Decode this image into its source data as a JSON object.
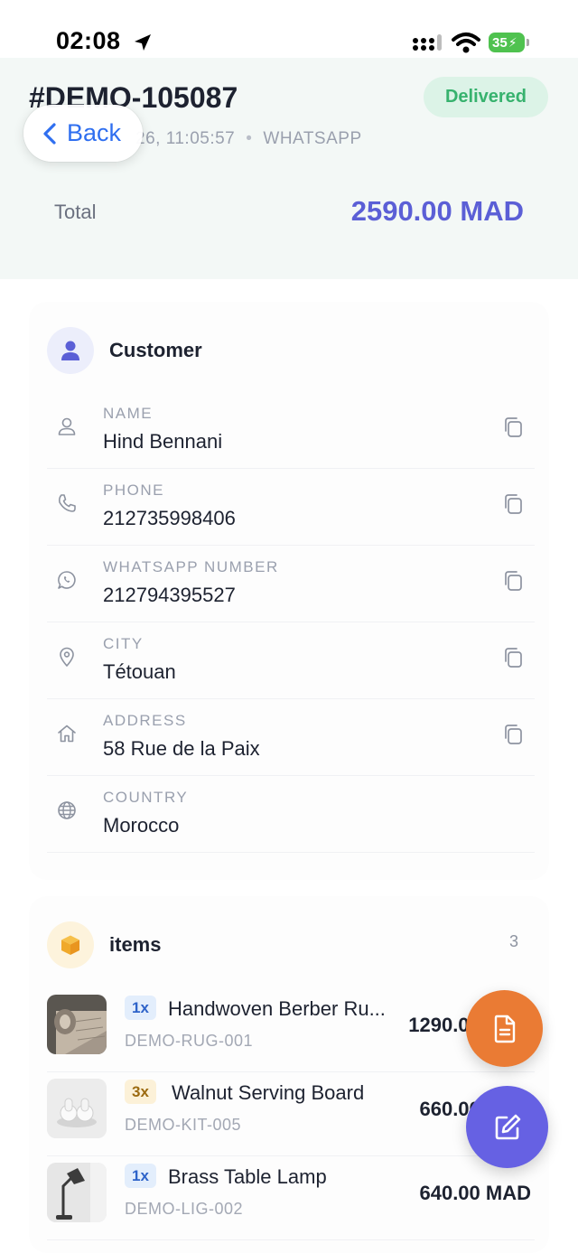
{
  "status_bar": {
    "time": "02:08",
    "battery": "35"
  },
  "order": {
    "id": "#DEMO-105087",
    "status": "Delivered",
    "datetime": "26, 11:05:57",
    "channel": "WHATSAPP",
    "total_label": "Total",
    "total_value": "2590.00 MAD"
  },
  "nav": {
    "back_label": "Back"
  },
  "colors": {
    "accent": "#5b5fd6",
    "status_green": "#37b26e",
    "invoice_fab": "#ea7b34",
    "edit_fab": "#6661e3"
  },
  "customer": {
    "title": "Customer",
    "fields": [
      {
        "icon": "person-icon",
        "label": "NAME",
        "value": "Hind Bennani",
        "copyable": true
      },
      {
        "icon": "phone-icon",
        "label": "PHONE",
        "value": "212735998406",
        "copyable": true
      },
      {
        "icon": "whatsapp-icon",
        "label": "WHATSAPP NUMBER",
        "value": "212794395527",
        "copyable": true
      },
      {
        "icon": "location-pin-icon",
        "label": "CITY",
        "value": "Tétouan",
        "copyable": true
      },
      {
        "icon": "home-icon",
        "label": "ADDRESS",
        "value": "58 Rue de la Paix",
        "copyable": true
      },
      {
        "icon": "globe-icon",
        "label": "COUNTRY",
        "value": "Morocco",
        "copyable": false
      }
    ]
  },
  "items": {
    "title": "items",
    "count": "3",
    "list": [
      {
        "qty": "1x",
        "name": "Handwoven Berber Ru...",
        "sku": "DEMO-RUG-001",
        "price": "1290.00 MAD"
      },
      {
        "qty": "3x",
        "name": "Walnut Serving Board",
        "sku": "DEMO-KIT-005",
        "price": "660.00 MAD"
      },
      {
        "qty": "1x",
        "name": "Brass Table Lamp",
        "sku": "DEMO-LIG-002",
        "price": "640.00 MAD"
      }
    ]
  },
  "fabs": {
    "invoice_icon": "document-icon",
    "edit_icon": "edit-icon"
  }
}
